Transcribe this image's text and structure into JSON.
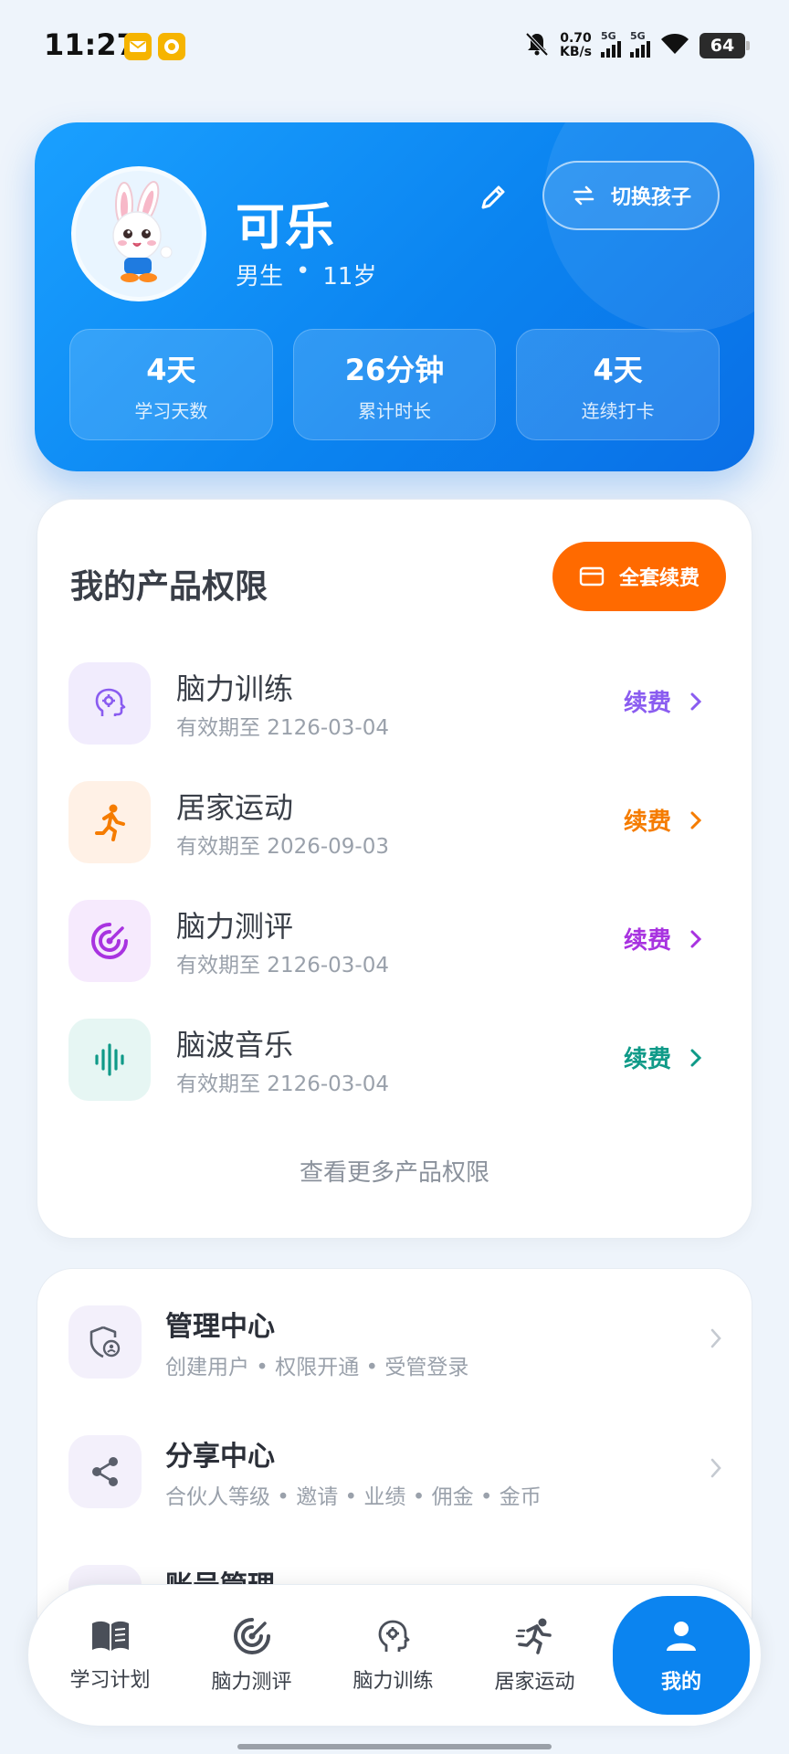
{
  "status_bar": {
    "time": "11:27",
    "net_speed_value": "0.70",
    "net_speed_unit": "KB/s",
    "signal1_label": "5G",
    "signal2_label": "5G",
    "battery": "64"
  },
  "profile": {
    "name": "可乐",
    "gender": "男生",
    "separator": "•",
    "age": "11岁",
    "switch_label": "切换孩子",
    "stats": [
      {
        "value": "4天",
        "label": "学习天数"
      },
      {
        "value": "26分钟",
        "label": "累计时长"
      },
      {
        "value": "4天",
        "label": "连续打卡"
      }
    ]
  },
  "products": {
    "title": "我的产品权限",
    "renew_all_label": "全套续费",
    "items": [
      {
        "name": "脑力训练",
        "expiry": "有效期至 2126-03-04",
        "action": "续费",
        "color": "#8a5cf0",
        "bg": "#f1ecfd",
        "icon": "brain-gear-icon"
      },
      {
        "name": "居家运动",
        "expiry": "有效期至 2026-09-03",
        "action": "续费",
        "color": "#f57c00",
        "bg": "#fff1e6",
        "icon": "running-icon"
      },
      {
        "name": "脑力测评",
        "expiry": "有效期至 2126-03-04",
        "action": "续费",
        "color": "#a833e0",
        "bg": "#f6eafd",
        "icon": "target-icon"
      },
      {
        "name": "脑波音乐",
        "expiry": "有效期至 2126-03-04",
        "action": "续费",
        "color": "#0f9a88",
        "bg": "#e6f6f3",
        "icon": "soundwave-icon"
      }
    ],
    "more_label": "查看更多产品权限"
  },
  "menu": {
    "items": [
      {
        "title": "管理中心",
        "subtitle": "创建用户 • 权限开通 • 受管登录",
        "icon": "shield-user-icon"
      },
      {
        "title": "分享中心",
        "subtitle": "合伙人等级 • 邀请 • 业绩 • 佣金 • 金币",
        "icon": "share-icon"
      },
      {
        "title": "账号管理",
        "subtitle": "",
        "icon": "account-icon"
      }
    ]
  },
  "nav": {
    "items": [
      {
        "label": "学习计划",
        "icon": "book-icon"
      },
      {
        "label": "脑力测评",
        "icon": "target-icon"
      },
      {
        "label": "脑力训练",
        "icon": "brain-gear-icon"
      },
      {
        "label": "居家运动",
        "icon": "running-icon"
      },
      {
        "label": "我的",
        "icon": "person-icon"
      }
    ],
    "active": "我的"
  },
  "colors": {
    "brand_blue": "#0b84f0",
    "accent_orange": "#ff6a00"
  }
}
